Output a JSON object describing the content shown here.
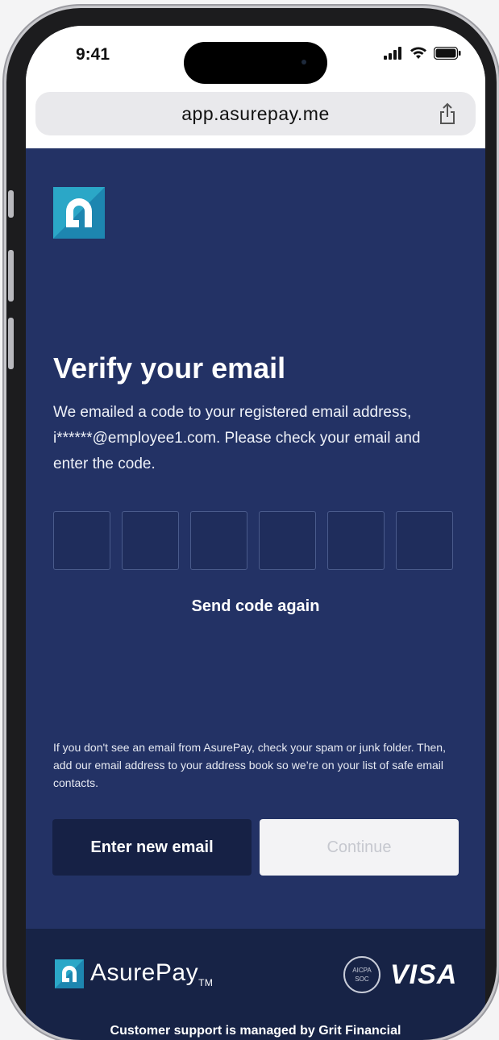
{
  "status_bar": {
    "time": "9:41"
  },
  "browser": {
    "url": "app.asurepay.me",
    "share_icon": "share-icon"
  },
  "page": {
    "title": "Verify your email",
    "description": "We emailed a code to your registered email address, i******@employee1.com. Please check your email and enter the code.",
    "code_boxes": 6,
    "resend_label": "Send code again",
    "note": "If you don't see an email from AsurePay, check your spam or junk folder. Then, add our email address to your address book so we’re on your list of safe email contacts.",
    "enter_new_email_label": "Enter new email",
    "continue_label": "Continue"
  },
  "footer": {
    "brand": "AsurePay",
    "brand_tm": "TM",
    "aicpa_badge": "AICPA SOC",
    "visa": "VISA",
    "support_text": "Customer support is managed by Grit Financial"
  },
  "colors": {
    "page_bg": "#233265",
    "footer_bg": "#172346",
    "button_dark": "#162145",
    "logo_teal": "#2ba7c7"
  }
}
